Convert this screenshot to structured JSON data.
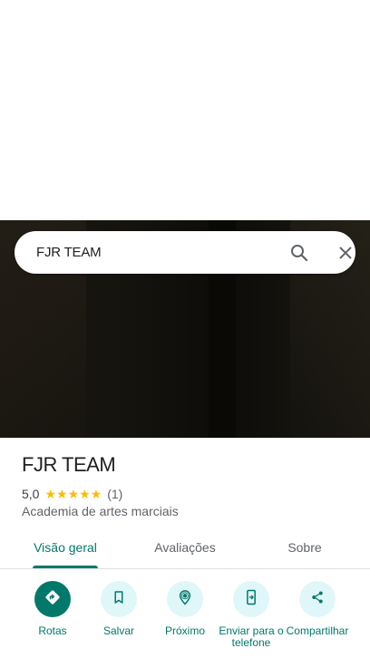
{
  "search": {
    "query": "FJR TEAM",
    "search_icon": "search-icon",
    "close_icon": "close-icon"
  },
  "place": {
    "name": "FJR TEAM",
    "rating": "5,0",
    "stars": "★★★★★",
    "reviews": "(1)",
    "category": "Academia de artes marciais"
  },
  "tabs": [
    {
      "label": "Visão geral",
      "active": true
    },
    {
      "label": "Avaliações",
      "active": false
    },
    {
      "label": "Sobre",
      "active": false
    }
  ],
  "actions": [
    {
      "label": "Rotas",
      "icon": "directions-icon"
    },
    {
      "label": "Salvar",
      "icon": "bookmark-icon"
    },
    {
      "label": "Próximo",
      "icon": "nearby-icon"
    },
    {
      "label": "Enviar para o telefone",
      "icon": "send-to-phone-icon"
    },
    {
      "label": "Compartilhar",
      "icon": "share-icon"
    }
  ],
  "colors": {
    "accent": "#00796b",
    "star": "#fbbc04",
    "action_bg": "#e0f7fa"
  }
}
